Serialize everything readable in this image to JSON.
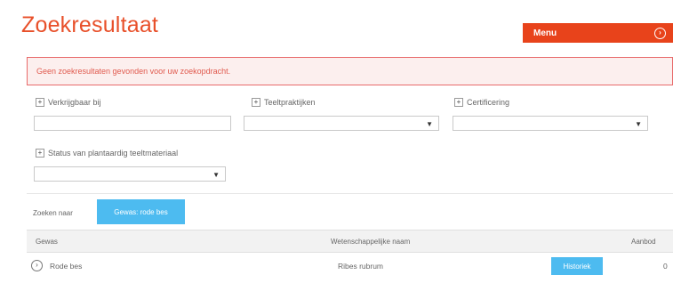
{
  "header": {
    "title": "Zoekresultaat",
    "menu_label": "Menu",
    "menu_icon": "circle-arrow-icon"
  },
  "alert": {
    "message": "Geen zoekresultaten gevonden voor uw zoekopdracht."
  },
  "filters": {
    "verkrijgbaar": {
      "label": "Verkrijgbaar bij",
      "toggle": "+"
    },
    "teeltpraktijken": {
      "label": "Teeltpraktijken",
      "toggle": "+"
    },
    "certificering": {
      "label": "Certificering",
      "toggle": "+"
    },
    "status": {
      "label": "Status van plantaardig teeltmateriaal",
      "toggle": "+"
    }
  },
  "search": {
    "label": "Zoeken naar",
    "term_button": "Gewas: rode bes"
  },
  "table": {
    "columns": [
      "Gewas",
      "Wetenschappelijke naam",
      "Aanbod"
    ],
    "rows": [
      {
        "gewas": "Rode bes",
        "wetenschappelijke_naam": "Ribes rubrum",
        "action": "Historiek",
        "aanbod": "0"
      }
    ]
  },
  "colors": {
    "accent": "#e8502a",
    "menu_bg": "#e8431b",
    "button_blue": "#4dbbf0",
    "alert_border": "#e86a6a"
  }
}
